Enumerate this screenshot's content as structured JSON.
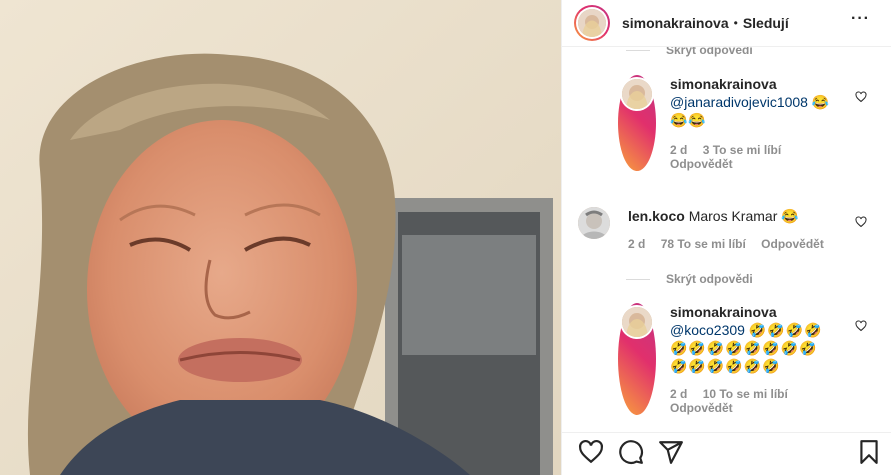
{
  "header": {
    "username": "simonakrainova",
    "separator": "•",
    "follow_label": "Sledují",
    "more_label": "···"
  },
  "comments": {
    "hide_replies_top": "Skrýt odpovědi",
    "reply1": {
      "username": "simonakrainova",
      "mention": "@janaradivojevic1008",
      "emoji_line1": "😂",
      "emoji_line2": "😂😂",
      "age": "2 d",
      "likes": "3 To se mi líbí",
      "reply_label": "Odpovědět"
    },
    "comment2": {
      "username": "len.koco",
      "text": "Maros Kramar",
      "emoji": "😂",
      "age": "2 d",
      "likes": "78 To se mi líbí",
      "reply_label": "Odpovědět"
    },
    "hide_replies_mid": "Skrýt odpovědi",
    "reply2": {
      "username": "simonakrainova",
      "mention": "@koco2309",
      "emoji_line1": "🤣🤣🤣🤣",
      "emoji_line2": "🤣🤣🤣🤣🤣🤣🤣🤣",
      "emoji_line3": "🤣🤣🤣🤣🤣🤣",
      "age": "2 d",
      "likes": "10 To se mi líbí",
      "reply_label": "Odpovědět"
    }
  },
  "actions": {
    "like": "heart-icon",
    "comment": "comment-icon",
    "share": "share-icon",
    "save": "bookmark-icon"
  },
  "colors": {
    "link": "#00376b",
    "muted": "#8e8e8e",
    "text": "#262626"
  }
}
